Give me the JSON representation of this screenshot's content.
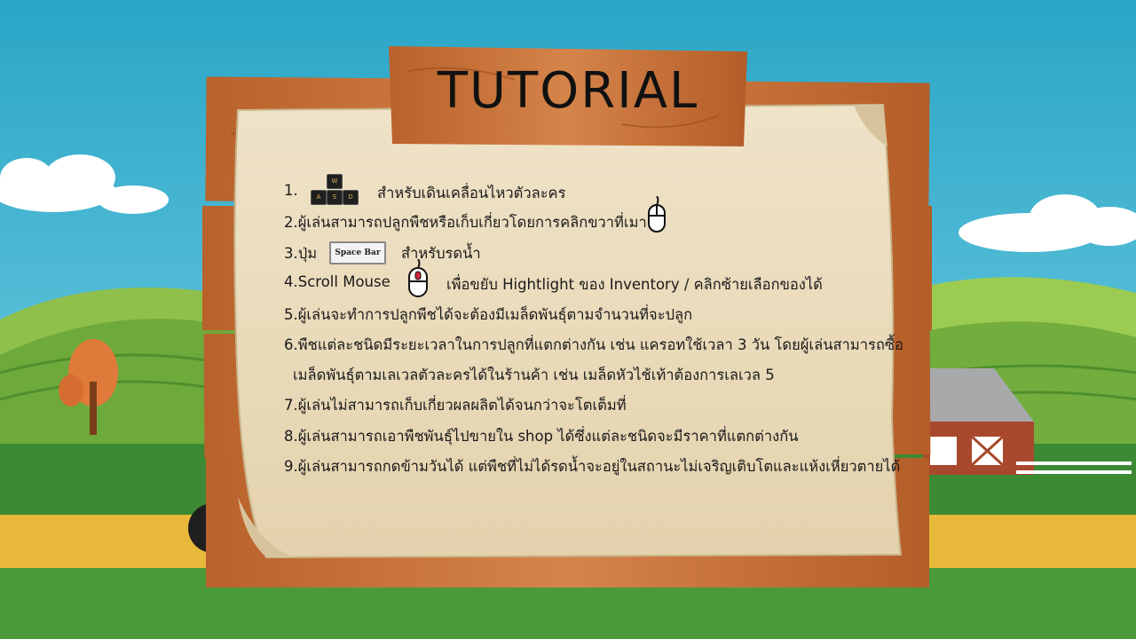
{
  "title": "TUTORIAL",
  "keys": {
    "w": "W",
    "a": "A",
    "s": "S",
    "d": "D"
  },
  "spacebar_label": "Space Bar",
  "instructions": {
    "l1_num": "1.",
    "l1_text": "สำหรับเดินเคลื่อนไหวตัวละคร",
    "l2": "2.ผู้เล่นสามารถปลูกพืชหรือเก็บเกี่ยวโดยการคลิกขวาที่เมาส์",
    "l3_pre": "3.ปุ่ม",
    "l3_text": "สำหรับรดน้ำ",
    "l4_pre": "4.Scroll Mouse",
    "l4_text": "เพื่อขยับ Hightlight ของ Inventory / คลิกซ้ายเลือกของได้",
    "l5": "5.ผู้เล่นจะทำการปลูกพืชได้จะต้องมีเมล็ดพันธุ์ตามจำนวนที่จะปลูก",
    "l6a": "6.พืชแต่ละชนิดมีระยะเวลาในการปลูกที่แตกต่างกัน เช่น แครอทใช้เวลา 3 วัน โดยผู้เล่นสามารถซื้อ",
    "l6b": "เมล็ดพันธุ์ตามเลเวลตัวละครได้ในร้านค้า เช่น เมล็ดหัวไช้เท้าต้องการเลเวล 5",
    "l7": "7.ผู้เล่นไม่สามารถเก็บเกี่ยวผลผลิตได้จนกว่าจะโตเต็มที่",
    "l8": "8.ผู้เล่นสามารถเอาพืชพันธุ์ไปขายใน shop ได้ซึ่งแต่ละชนิดจะมีราคาที่แตกต่างกัน",
    "l9": "9.ผู้เล่นสามารถกดข้ามวันได้ แต่พืชที่ไม่ได้รดน้ำจะอยู่ในสถานะไม่เจริญเติบโตและแห้งเหี่ยวตายได้"
  },
  "icons": [
    "wasd-keys-icon",
    "mouse-right-click-icon",
    "mouse-scroll-icon",
    "spacebar-key-icon"
  ],
  "colors": {
    "sky": "#3db4d3",
    "wood": "#c9743a",
    "paper": "#ede1c6",
    "grass": "#5fa53a"
  }
}
